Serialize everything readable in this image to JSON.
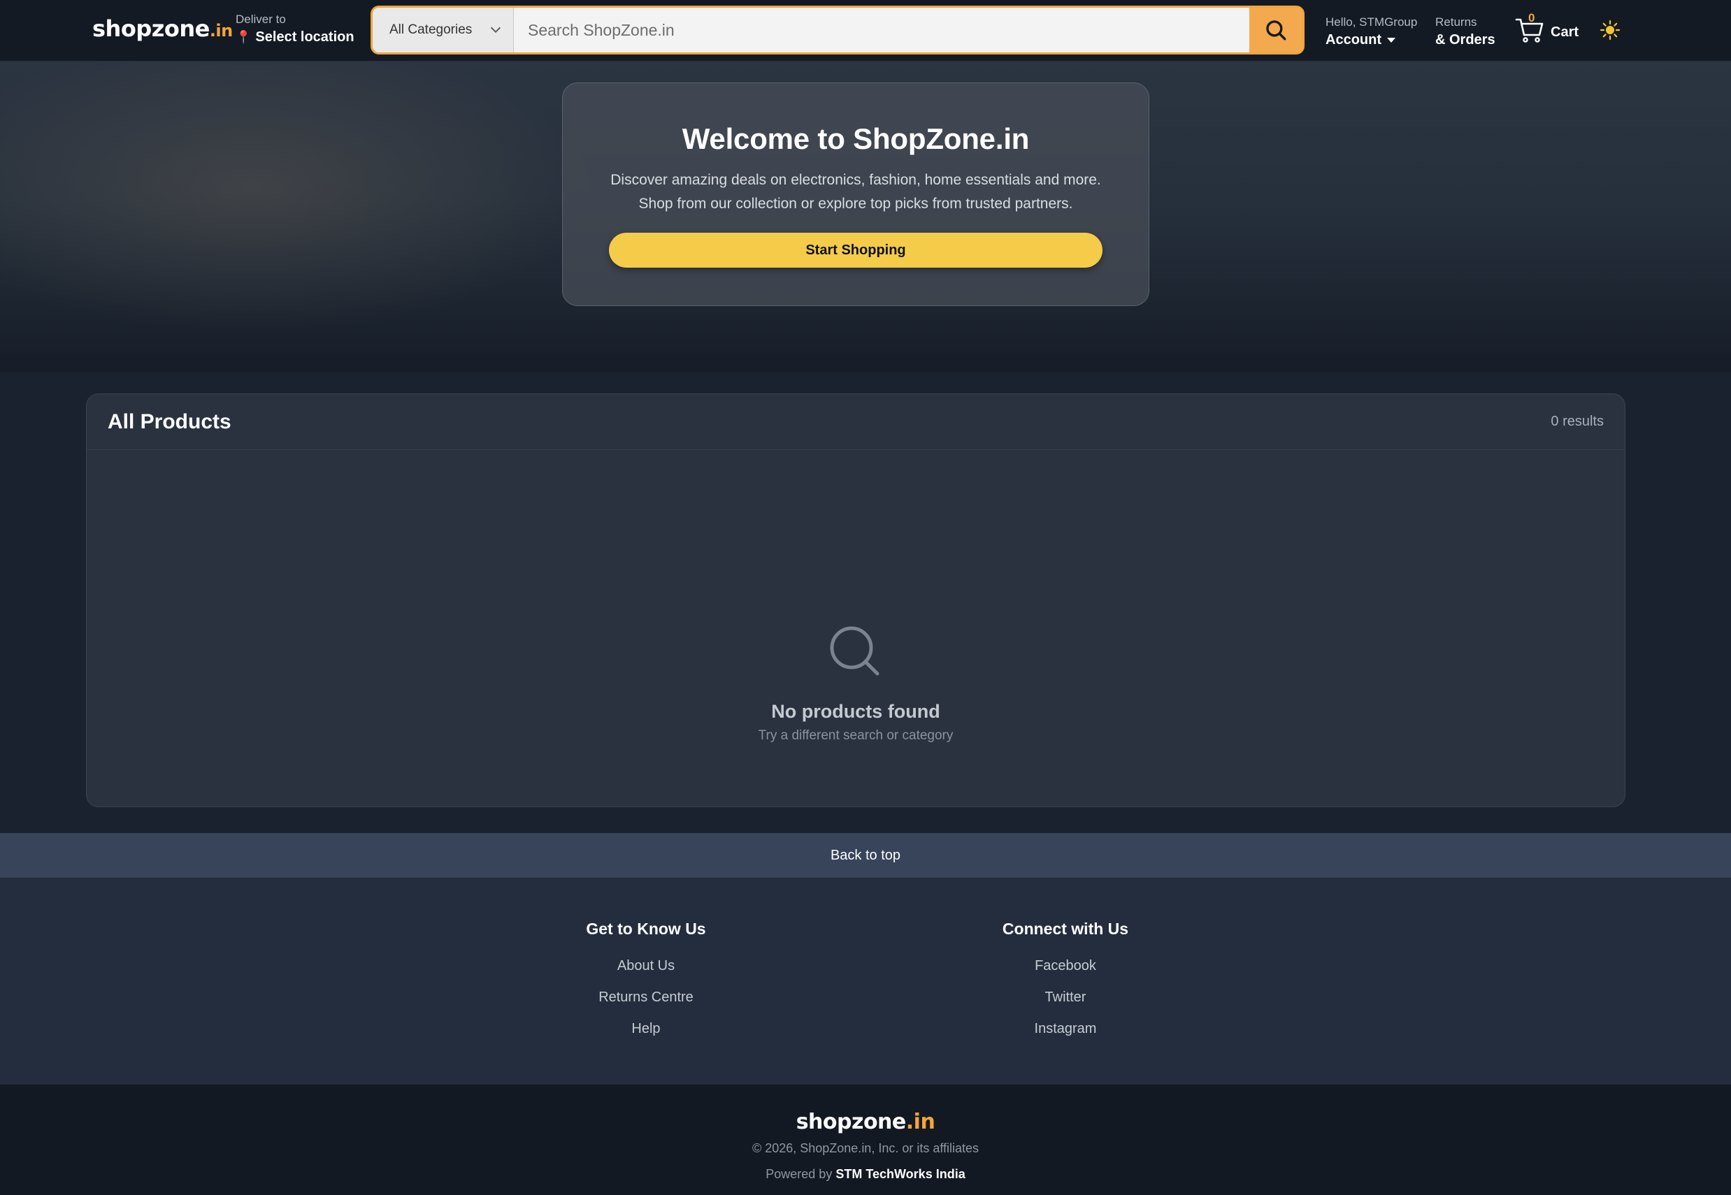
{
  "header": {
    "logo_main": "shopzone",
    "logo_tld": ".in",
    "deliver_label": "Deliver to",
    "deliver_value": "Select location",
    "search": {
      "category": "All Categories",
      "placeholder": "Search ShopZone.in",
      "value": ""
    },
    "account_greeting": "Hello, STMGroup",
    "account_label": "Account",
    "orders_small": "Returns",
    "orders_big": "& Orders",
    "cart_count": "0",
    "cart_label": "Cart",
    "theme_icon": "sun-icon"
  },
  "hero": {
    "title": "Welcome to ShopZone.in",
    "line1": "Discover amazing deals on electronics, fashion, home essentials and more.",
    "line2": "Shop from our collection or explore top picks from trusted partners.",
    "cta": "Start Shopping"
  },
  "products": {
    "title": "All Products",
    "count": "0 results",
    "empty_title": "No products found",
    "empty_subtitle": "Try a different search or category"
  },
  "back_to_top": "Back to top",
  "footer": {
    "col1": {
      "title": "Get to Know Us",
      "links": [
        "About Us",
        "Returns Centre",
        "Help"
      ]
    },
    "col2": {
      "title": "Connect with Us",
      "links": [
        "Facebook",
        "Twitter",
        "Instagram"
      ]
    },
    "logo_main": "shopzone",
    "logo_tld": ".in",
    "copyright": "© 2026, ShopZone.in, Inc. or its affiliates",
    "powered_prefix": "Powered by",
    "powered_by": "STM TechWorks India"
  },
  "colors": {
    "accent": "#f3a53a",
    "cta": "#f4cc4a",
    "header_bg": "#131a24"
  }
}
